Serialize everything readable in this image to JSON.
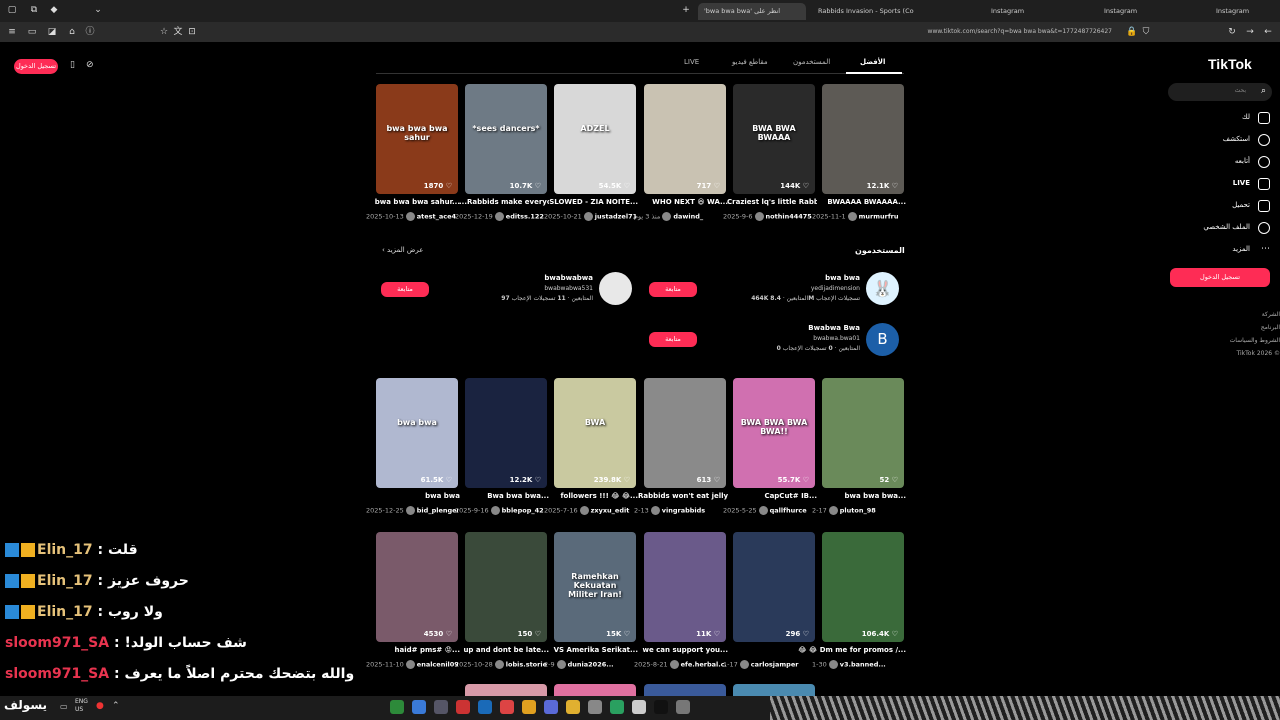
{
  "browser": {
    "tabs": [
      {
        "label": "'bwa bwa bwa' انظر على",
        "active": true
      },
      {
        "label": "Rabbids Invasion - Sports (Co",
        "active": false
      },
      {
        "label": "Instagram",
        "active": false
      },
      {
        "label": "Instagram",
        "active": false
      },
      {
        "label": "Instagram",
        "active": false
      }
    ],
    "url": "www.tiktok.com/search?q=bwa bwa bwa&t=1772487726427"
  },
  "left_overlay": {
    "login_label": "تسجيل الدخول"
  },
  "sidebar": {
    "logo": "TikTok",
    "search_placeholder": "بحث",
    "items": [
      {
        "label": "لك",
        "icon": "home-icon"
      },
      {
        "label": "استكشف",
        "icon": "compass-icon"
      },
      {
        "label": "أتابعه",
        "icon": "following-icon"
      },
      {
        "label": "LIVE",
        "icon": "live-icon"
      },
      {
        "label": "تحميل",
        "icon": "upload-icon"
      },
      {
        "label": "الملف الشخصي",
        "icon": "profile-icon"
      },
      {
        "label": "المزيد",
        "icon": "more-icon"
      }
    ],
    "login_label": "تسجيل الدخول",
    "footer": [
      "الشركة",
      "البرنامج",
      "الشروط والسياسات",
      "TikTok 2026 ©"
    ]
  },
  "search_tabs": [
    {
      "label": "الأفضل",
      "active": true
    },
    {
      "label": "المستخدمون",
      "active": false
    },
    {
      "label": "مقاطع فيديو",
      "active": false
    },
    {
      "label": "LIVE",
      "active": false
    }
  ],
  "row1": [
    {
      "likes": "12.1K",
      "title": "BWAAAA BWAAAA...",
      "user": "murmurfru",
      "date": "2025-11-1",
      "color": "#5d5a55"
    },
    {
      "likes": "144K",
      "title": "Craziest lq's little Rabbids",
      "user": "nothin44475",
      "date": "2025-9-6",
      "color": "#2a2a2a",
      "overlay": "BWA BWA BWAAA"
    },
    {
      "likes": "717",
      "title": "WHO NEXT 😆 WA...",
      "user": "dawind_",
      "date": "منذ 3 يوم",
      "color": "#c9c2b2"
    },
    {
      "likes": "54.5K",
      "title": "SLOWED - ZIA NOITE...",
      "user": "justadzel71",
      "date": "2025-10-21",
      "color": "#d8d8d8",
      "overlay": "ADZEL"
    },
    {
      "likes": "10.7K",
      "title": "...Rabbids make everyone",
      "user": "editss.122",
      "date": "2025-12-19",
      "color": "#6e7a85",
      "overlay": "*sees dancers*"
    },
    {
      "likes": "1870",
      "title": "bwa bwa bwa sahur...",
      "user": "atest_ace4",
      "date": "2025-10-13",
      "color": "#8a3a1a",
      "overlay": "bwa bwa bwa sahur"
    }
  ],
  "users_section": {
    "title": "المستخدمون",
    "more": "عرض المزيد",
    "users": [
      {
        "name": "bwa bwa",
        "handle": "yedijadimension",
        "followers": "464K",
        "followers_label": "المتابعين",
        "likes": "8.4M",
        "likes_label": "تسجيلات الإعجاب",
        "follow": "متابعة",
        "avatar_color": "#dff3ff"
      },
      {
        "name": "bwabwabwa",
        "handle": "bwabwabwa531",
        "followers": "97",
        "followers_label": "المتابعين",
        "likes": "11",
        "likes_label": "تسجيلات الإعجاب",
        "follow": "متابعة",
        "avatar_color": "#e8e8e8"
      },
      {
        "name": "Bwabwa Bwa",
        "handle": "bwabwa.bwa01",
        "followers": "0",
        "followers_label": "المتابعين",
        "likes": "0",
        "likes_label": "تسجيلات الإعجاب",
        "follow": "متابعة",
        "avatar_color": "#1c5fa8",
        "avatar_letter": "B"
      }
    ]
  },
  "row2": [
    {
      "likes": "52",
      "title": "bwa bwa bwa...",
      "user": "pluton_98",
      "date": "2-17",
      "color": "#6a8a5a"
    },
    {
      "likes": "55.7K",
      "title": "CapCut# IB...",
      "user": "qallfhurce",
      "date": "2025-5-25",
      "color": "#d070b0",
      "overlay": "BWA BWA BWA BWA!!"
    },
    {
      "likes": "613",
      "title": "Rabbids won't eat jelly...",
      "user": "vingrabbids",
      "date": "2-13",
      "color": "#8a8a8a"
    },
    {
      "likes": "239.8K",
      "title": "followers !!! 😂 😂...",
      "user": "zxyxu_edit",
      "date": "2025-7-16",
      "color": "#c9c9a0",
      "overlay": "BWA"
    },
    {
      "likes": "12.2K",
      "title": "Bwa bwa bwa...",
      "user": "bblepop_42",
      "date": "2025-9-16",
      "color": "#1a2340"
    },
    {
      "likes": "61.5K",
      "title": "bwa bwa",
      "user": "bid_plenger...",
      "date": "2025-12-25",
      "color": "#b0b8d0",
      "overlay": "bwa bwa"
    }
  ],
  "row3": [
    {
      "likes": "106.4K",
      "title": "Dm me for promos /...",
      "user": "v3.banned...",
      "date": "1-30",
      "color": "#3a6a3a"
    },
    {
      "likes": "296",
      "title": "😂 😂",
      "user": "carlosjamper",
      "date": "1-17",
      "color": "#2a3a5a"
    },
    {
      "likes": "11K",
      "title": "we can support you...",
      "user": "efe.herbal.c...",
      "date": "2025-8-21",
      "color": "#6a5a8a"
    },
    {
      "likes": "15K",
      "title": "VS Amerika Serikat...",
      "user": "dunia2026...",
      "date": "2-9",
      "color": "#5a6a7a",
      "overlay": "Ramehkan Kekuatan Militer Iran!"
    },
    {
      "likes": "150",
      "title": "up and dont be late...",
      "user": "lobis.stories",
      "date": "2025-10-28",
      "color": "#3a4a3a"
    },
    {
      "likes": "4530",
      "title": "haid# pms# 😡...",
      "user": "enalcenil09...",
      "date": "2025-11-10",
      "color": "#7a5a6a"
    }
  ],
  "chat": [
    {
      "user": "Elin_17",
      "message": "قلت",
      "user_color": "#e6c27a"
    },
    {
      "user": "Elin_17",
      "message": "حروف عزيز",
      "user_color": "#e6c27a"
    },
    {
      "user": "Elin_17",
      "message": "ولا روب",
      "user_color": "#e6c27a"
    },
    {
      "user": "sloom971_SA",
      "message": "!شف حساب الولد",
      "user_color": "#e8344f"
    },
    {
      "user": "sloom971_SA",
      "message": "والله بتضحك محترم اصلاً ما يعرف",
      "user_color": "#e8344f"
    }
  ],
  "taskbar": {
    "brand": "يسولف",
    "lang": "ENG",
    "region": "US"
  }
}
